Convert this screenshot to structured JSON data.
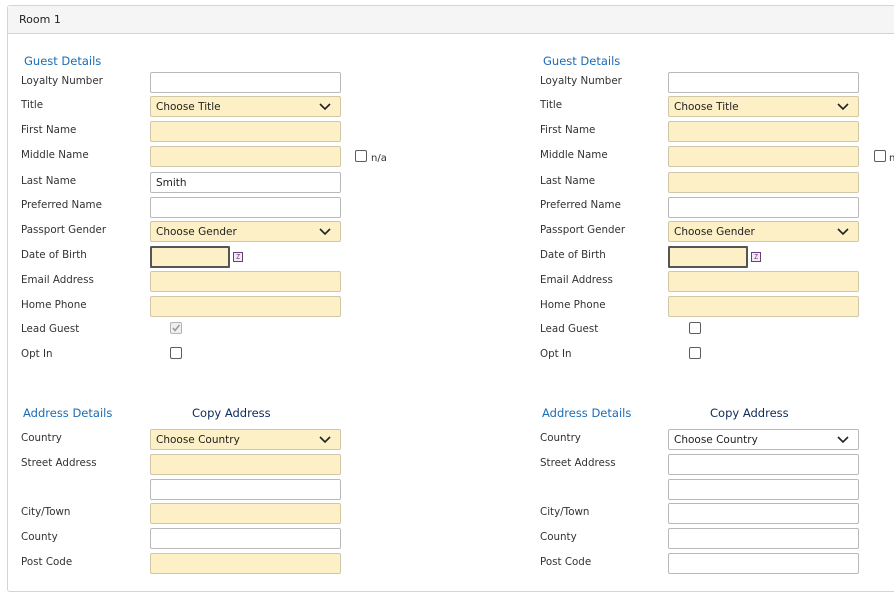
{
  "panel": {
    "title": "Room 1"
  },
  "guest_columns": [
    {
      "section_title": "Guest Details",
      "labels": {
        "loyalty": "Loyalty Number",
        "title": "Title",
        "first": "First Name",
        "middle": "Middle Name",
        "last": "Last Name",
        "preferred": "Preferred Name",
        "gender": "Passport Gender",
        "dob": "Date of Birth",
        "email": "Email Address",
        "phone": "Home Phone",
        "lead": "Lead Guest",
        "optin": "Opt In"
      },
      "values": {
        "loyalty": "",
        "title": "Choose Title",
        "first": "",
        "middle": "",
        "last": "Smith",
        "preferred": "",
        "gender": "Choose Gender",
        "dob": "",
        "email": "",
        "phone": ""
      },
      "middle_na_label": "n/a",
      "lead_checked": true,
      "lead_disabled": true,
      "optin_checked": false
    },
    {
      "section_title": "Guest Details",
      "labels": {
        "loyalty": "Loyalty Number",
        "title": "Title",
        "first": "First Name",
        "middle": "Middle Name",
        "last": "Last Name",
        "preferred": "Preferred Name",
        "gender": "Passport Gender",
        "dob": "Date of Birth",
        "email": "Email Address",
        "phone": "Home Phone",
        "lead": "Lead Guest",
        "optin": "Opt In"
      },
      "values": {
        "loyalty": "",
        "title": "Choose Title",
        "first": "",
        "middle": "",
        "last": "",
        "preferred": "",
        "gender": "Choose Gender",
        "dob": "",
        "email": "",
        "phone": ""
      },
      "middle_na_label": "n",
      "lead_checked": false,
      "lead_disabled": false,
      "optin_checked": false
    }
  ],
  "address_columns": [
    {
      "section_title": "Address Details",
      "copy_label": "Copy Address",
      "labels": {
        "country": "Country",
        "street": "Street Address",
        "city": "City/Town",
        "county": "County",
        "postcode": "Post Code"
      },
      "values": {
        "country": "Choose Country",
        "street1": "",
        "street2": "",
        "city": "",
        "county": "",
        "postcode": ""
      }
    },
    {
      "section_title": "Address Details",
      "copy_label": "Copy Address",
      "labels": {
        "country": "Country",
        "street": "Street Address",
        "city": "City/Town",
        "county": "County",
        "postcode": "Post Code"
      },
      "values": {
        "country": "Choose Country",
        "street1": "",
        "street2": "",
        "city": "",
        "county": "",
        "postcode": ""
      }
    }
  ],
  "icons": {
    "select_arrow": "chevron-down-icon",
    "date_picker": "calendar-icon",
    "checkmark": "checkmark-icon"
  },
  "colors": {
    "required_field_bg": "#fdf0c6",
    "section_title": "#1c6bb5",
    "copy_address": "#0d2a59"
  }
}
